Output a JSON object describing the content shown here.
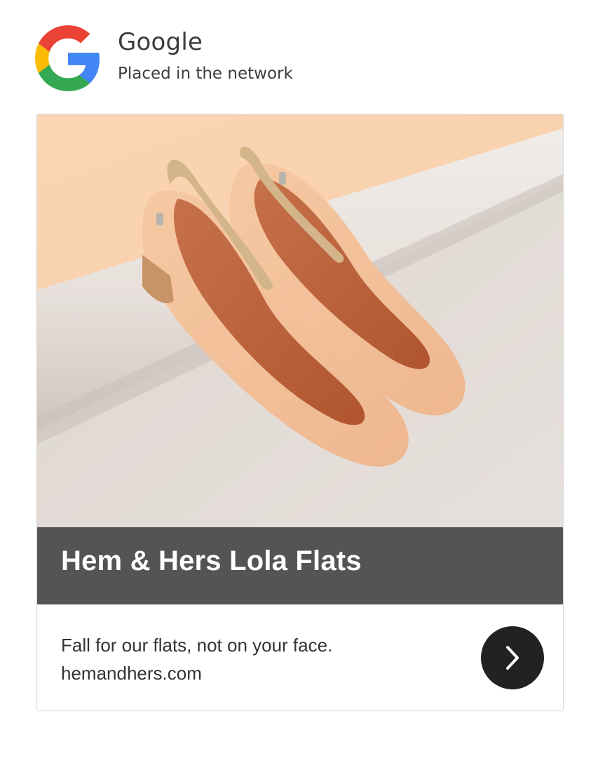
{
  "header": {
    "logo_icon": "google-g-icon",
    "brand_name": "Google",
    "subtitle": "Placed in the network"
  },
  "ad": {
    "image_alt": "beige ankle-strap ballet flats on a rolled backdrop",
    "headline": "Hem & Hers Lola Flats",
    "description": "Fall for our flats, not on your face.",
    "url": "hemandhers.com",
    "cta_icon": "chevron-right-icon"
  },
  "colors": {
    "google_blue": "#4285F4",
    "google_red": "#EA4335",
    "google_yellow": "#FBBC05",
    "google_green": "#34A853",
    "title_bar": "#545454",
    "cta_bg": "#222222"
  }
}
